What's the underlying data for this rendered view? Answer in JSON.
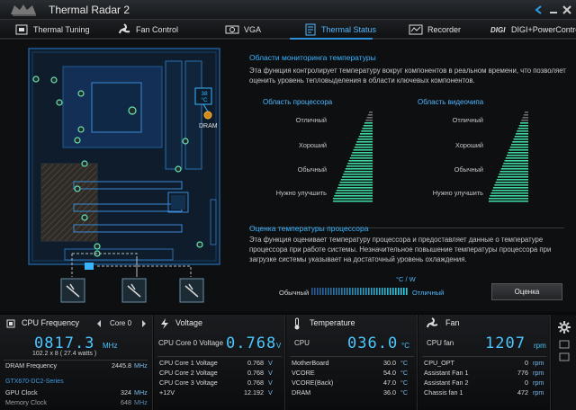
{
  "app": {
    "title": "Thermal Radar 2"
  },
  "tabs": [
    {
      "label": "Thermal Tuning"
    },
    {
      "label": "Fan Control"
    },
    {
      "label": "VGA"
    },
    {
      "label": "Thermal Status"
    },
    {
      "label": "Recorder"
    },
    {
      "label": "DIGI+PowerControl"
    }
  ],
  "board": {
    "temp_label": "38 °C",
    "dram_label": "DRAM"
  },
  "monitor": {
    "heading": "Области мониторинга температуры",
    "description": "Эта функция контролирует температуру вокруг компонентов в реальном времени, что позволяет оценить уровень тепловыделения в области ключевых компонентов.",
    "cpu_area": "Область процессора",
    "gpu_area": "Область видеочипа",
    "levels": [
      "Отличный",
      "Хороший",
      "Обычный",
      "Нужно улучшить"
    ]
  },
  "eval": {
    "heading": "Оценка температуры процессора",
    "description": "Эта функция оценивает температуру процессора и предоставляет данные о температуре процессора при работе системы. Незначительное повышение температуры процессора при загрузке системы указывает на достаточный уровень охлаждения.",
    "unit_label": "°C / W",
    "left_label": "Обычный",
    "right_label": "Отличный",
    "button": "Оценка"
  },
  "cpu_freq": {
    "title": "CPU Frequency",
    "core_select": "Core 0",
    "value": "0817.3",
    "unit": "MHz",
    "sub": "102.2  x  8    ( 27.4    watts )",
    "dram_label": "DRAM Frequency",
    "dram_value": "2445.8",
    "dram_unit": "MHz",
    "gpu_name": "GTX670-DC2-Series",
    "gpu_clock_label": "GPU Clock",
    "gpu_clock_value": "324",
    "gpu_clock_unit": "MHz",
    "mem_clock_label": "Memory Clock",
    "mem_clock_value": "648",
    "mem_clock_unit": "MHz"
  },
  "voltage": {
    "title": "Voltage",
    "main_label": "CPU Core 0 Voltage",
    "main_value": "0.768",
    "main_unit": "V",
    "rows": [
      {
        "label": "CPU Core 1 Voltage",
        "value": "0.768",
        "unit": "V"
      },
      {
        "label": "CPU Core 2 Voltage",
        "value": "0.768",
        "unit": "V"
      },
      {
        "label": "CPU Core 3 Voltage",
        "value": "0.768",
        "unit": "V"
      },
      {
        "label": "+12V",
        "value": "12.192",
        "unit": "V"
      }
    ]
  },
  "temperature": {
    "title": "Temperature",
    "main_label": "CPU",
    "main_value": "036.0",
    "main_unit": "°C",
    "rows": [
      {
        "label": "MotherBoard",
        "value": "30.0",
        "unit": "°C"
      },
      {
        "label": "VCORE",
        "value": "54.0",
        "unit": "°C"
      },
      {
        "label": "VCORE(Back)",
        "value": "47.0",
        "unit": "°C"
      },
      {
        "label": "DRAM",
        "value": "36.0",
        "unit": "°C"
      }
    ]
  },
  "fan": {
    "title": "Fan",
    "main_label": "CPU fan",
    "main_value": "1207",
    "main_unit": "rpm",
    "rows": [
      {
        "label": "CPU_OPT",
        "value": "0",
        "unit": "rpm"
      },
      {
        "label": "Assistant Fan 1",
        "value": "776",
        "unit": "rpm"
      },
      {
        "label": "Assistant Fan 2",
        "value": "0",
        "unit": "rpm"
      },
      {
        "label": "Chassis fan 1",
        "value": "472",
        "unit": "rpm"
      }
    ]
  },
  "colors": {
    "accent": "#39b4ff",
    "bar": "#3fd6a0"
  }
}
